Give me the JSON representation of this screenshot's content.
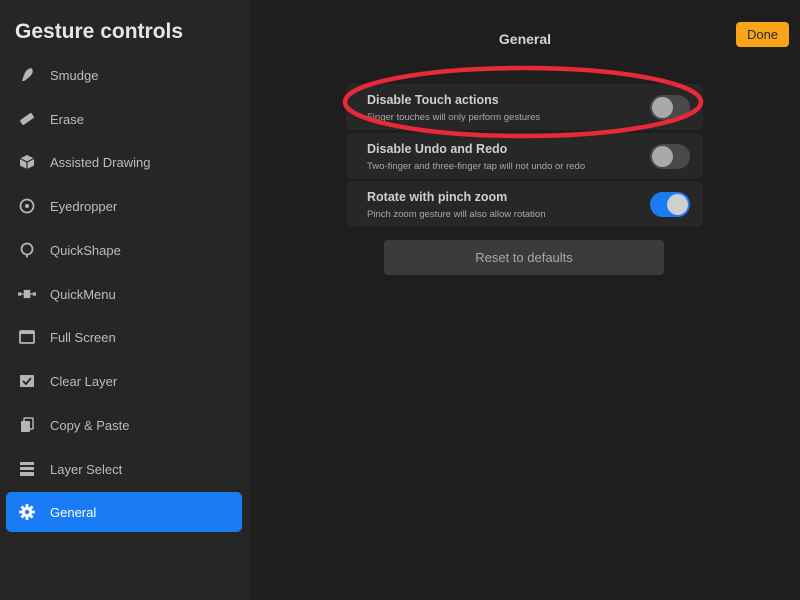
{
  "sidebar": {
    "title": "Gesture controls",
    "items": [
      {
        "label": "Smudge",
        "icon": "smudge-icon"
      },
      {
        "label": "Erase",
        "icon": "eraser-icon"
      },
      {
        "label": "Assisted Drawing",
        "icon": "cube-icon"
      },
      {
        "label": "Eyedropper",
        "icon": "eyedropper-icon"
      },
      {
        "label": "QuickShape",
        "icon": "quickshape-icon"
      },
      {
        "label": "QuickMenu",
        "icon": "quickmenu-icon"
      },
      {
        "label": "Full Screen",
        "icon": "full-screen-icon"
      },
      {
        "label": "Clear Layer",
        "icon": "clear-layer-icon"
      },
      {
        "label": "Copy & Paste",
        "icon": "copy-paste-icon"
      },
      {
        "label": "Layer Select",
        "icon": "layer-select-icon"
      },
      {
        "label": "General",
        "icon": "gear-icon",
        "active": true
      }
    ]
  },
  "header": {
    "title": "General",
    "done_label": "Done"
  },
  "settings": [
    {
      "label": "Disable Touch actions",
      "description": "Finger touches will only perform gestures",
      "enabled": false
    },
    {
      "label": "Disable Undo and Redo",
      "description": "Two-finger and three-finger tap will not undo or redo",
      "enabled": false
    },
    {
      "label": "Rotate with pinch zoom",
      "description": "Pinch zoom gesture will also allow rotation",
      "enabled": true
    }
  ],
  "reset_label": "Reset to defaults",
  "colors": {
    "accent": "#1a7cf5",
    "done_button": "#f9a51a",
    "annotation": "#e8293a"
  }
}
